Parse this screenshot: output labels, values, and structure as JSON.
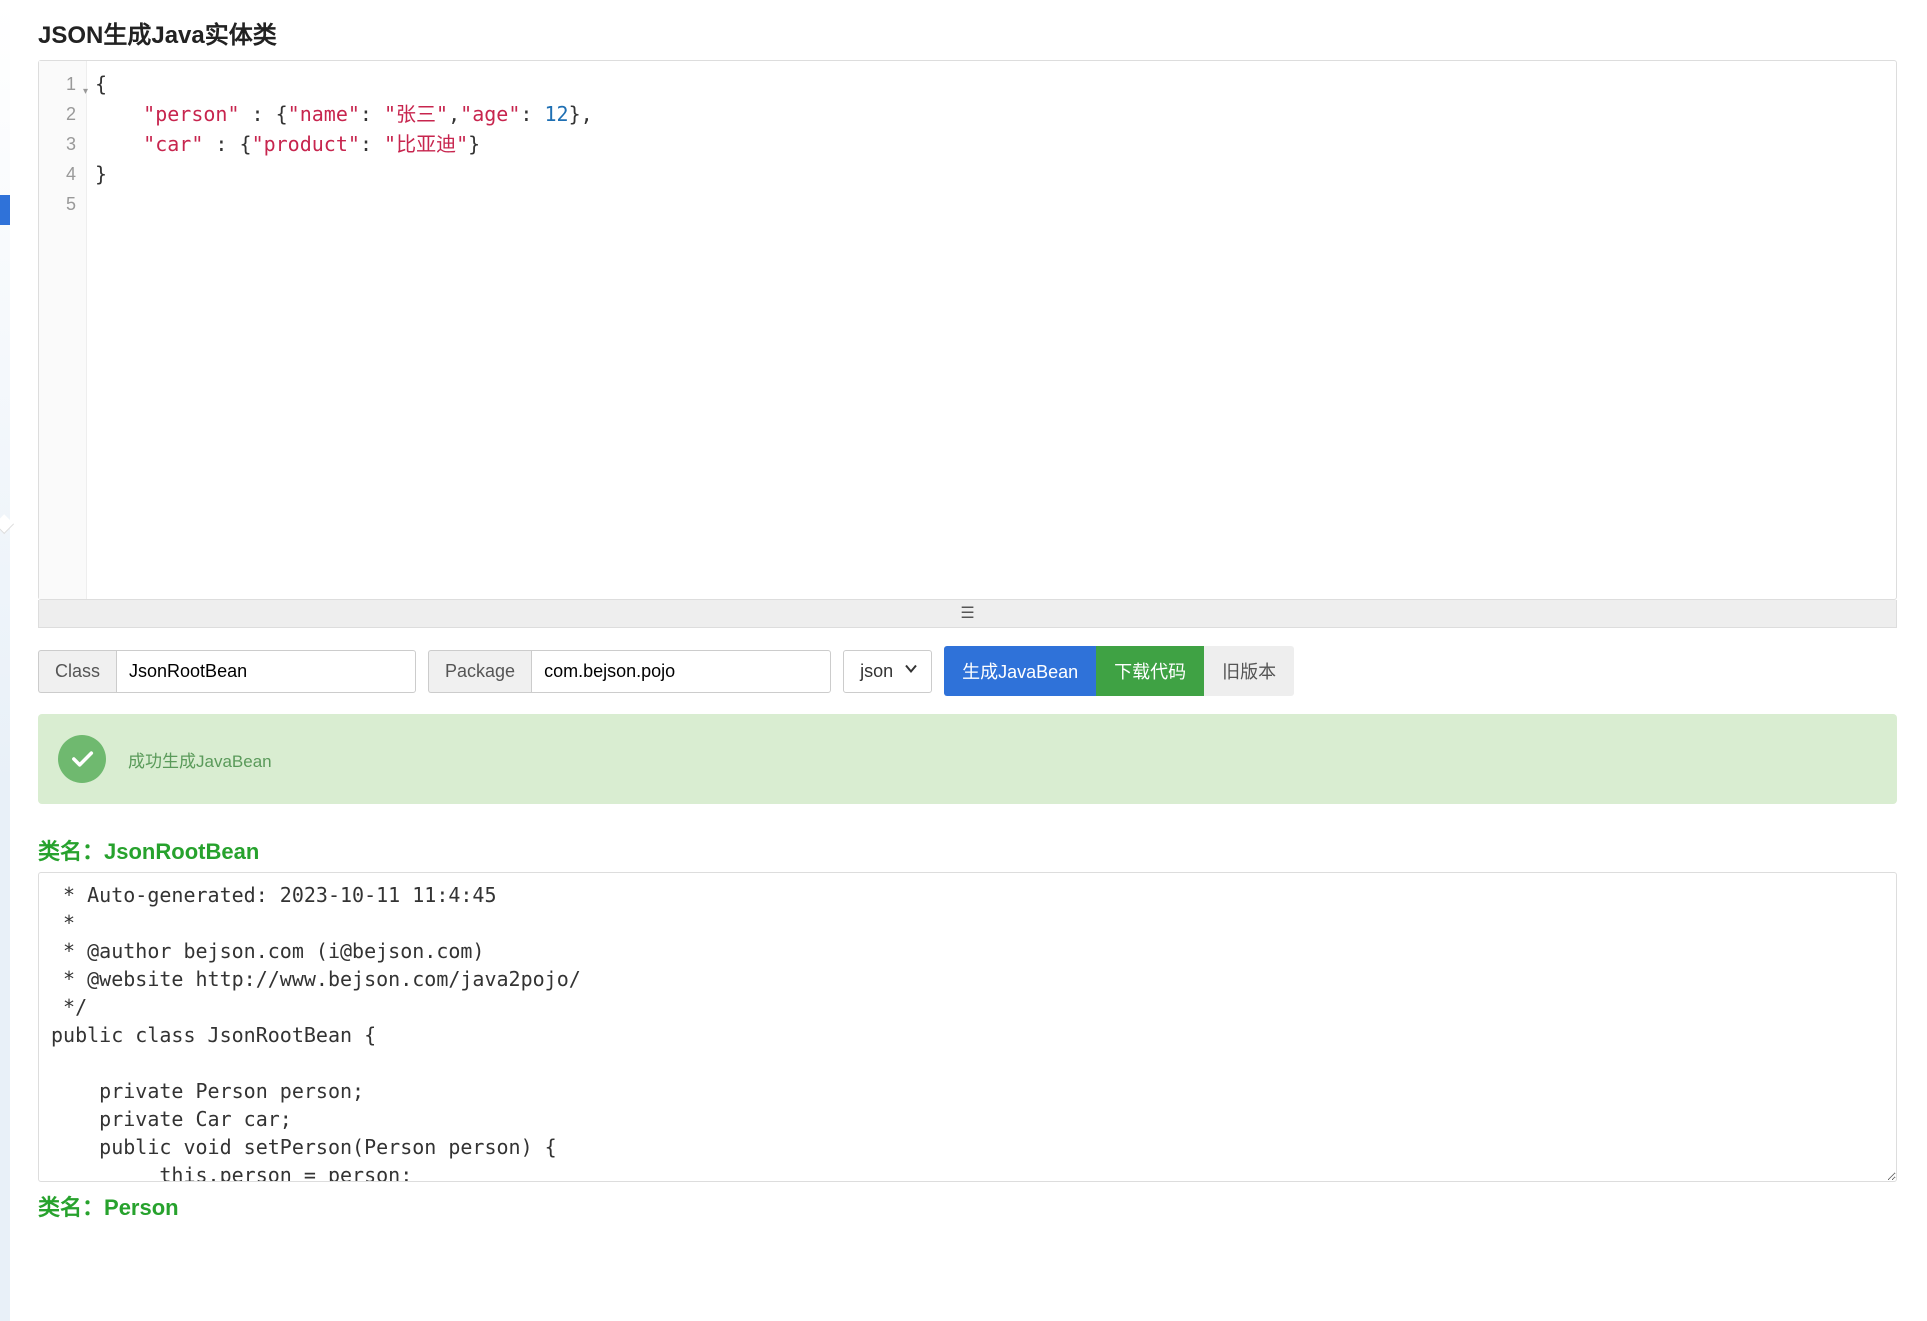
{
  "page": {
    "title": "JSON生成Java实体类"
  },
  "editor": {
    "line_numbers": [
      "1",
      "2",
      "3",
      "4",
      "5"
    ],
    "lines": [
      [
        {
          "t": "brace",
          "v": "{"
        }
      ],
      [
        {
          "t": "indent",
          "v": "    "
        },
        {
          "t": "key",
          "v": "\"person\""
        },
        {
          "t": "punc",
          "v": " : {"
        },
        {
          "t": "key",
          "v": "\"name\""
        },
        {
          "t": "punc",
          "v": ": "
        },
        {
          "t": "str",
          "v": "\"张三\""
        },
        {
          "t": "punc",
          "v": ","
        },
        {
          "t": "key",
          "v": "\"age\""
        },
        {
          "t": "punc",
          "v": ": "
        },
        {
          "t": "num",
          "v": "12"
        },
        {
          "t": "punc",
          "v": "},"
        }
      ],
      [
        {
          "t": "indent",
          "v": "    "
        },
        {
          "t": "key",
          "v": "\"car\""
        },
        {
          "t": "punc",
          "v": " : {"
        },
        {
          "t": "key",
          "v": "\"product\""
        },
        {
          "t": "punc",
          "v": ": "
        },
        {
          "t": "str",
          "v": "\"比亚迪\""
        },
        {
          "t": "punc",
          "v": "}"
        }
      ],
      [
        {
          "t": "brace",
          "v": "}"
        }
      ],
      []
    ]
  },
  "controls": {
    "class_label": "Class",
    "class_value": "JsonRootBean",
    "package_label": "Package",
    "package_value": "com.bejson.pojo",
    "format_select": "json",
    "btn_generate": "生成JavaBean",
    "btn_download": "下载代码",
    "btn_old": "旧版本"
  },
  "alert": {
    "message": "成功生成JavaBean"
  },
  "output": {
    "class1_header_prefix": "类名：",
    "class1_name": "JsonRootBean",
    "class1_code": " * Auto-generated: 2023-10-11 11:4:45\n *\n * @author bejson.com (i@bejson.com)\n * @website http://www.bejson.com/java2pojo/\n */\npublic class JsonRootBean {\n\n    private Person person;\n    private Car car;\n    public void setPerson(Person person) {\n         this.person = person;\n     }",
    "class2_header_prefix": "类名：",
    "class2_name": "Person"
  }
}
